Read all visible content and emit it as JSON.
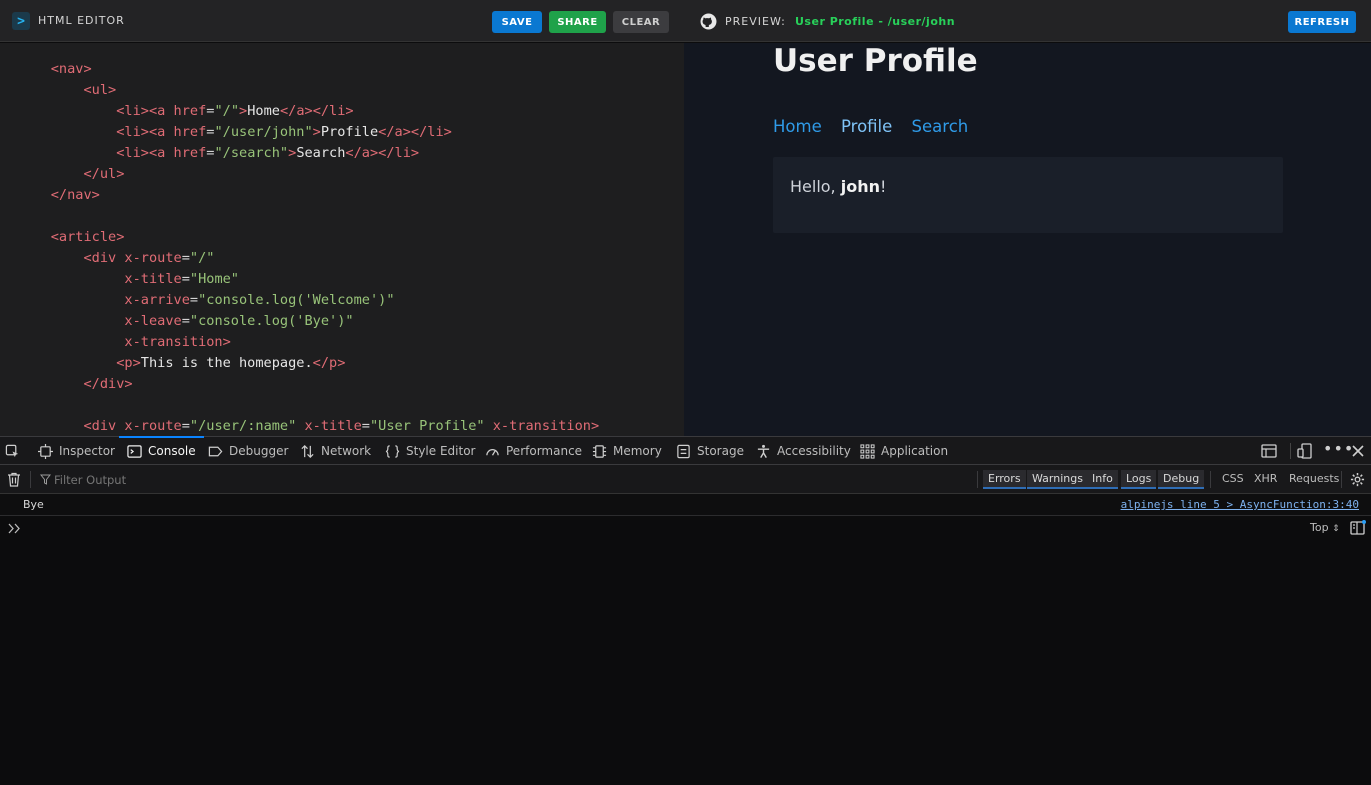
{
  "app": {
    "title": "HTML EDITOR",
    "buttons": {
      "save": "SAVE",
      "share": "SHARE",
      "clear": "CLEAR",
      "refresh": "REFRESH"
    },
    "preview_label": "PREVIEW:",
    "preview_url": "User Profile - /user/john",
    "colors": {
      "save": "#0a78d1",
      "share": "#1fa24a",
      "clear": "#3c3c3f",
      "url": "#28d15a"
    }
  },
  "preview": {
    "heading": "User Profile",
    "nav": [
      "Home",
      "Profile",
      "Search"
    ],
    "greeting_prefix": "Hello, ",
    "greeting_name": "john",
    "greeting_suffix": "!"
  },
  "devtools": {
    "tabs": [
      "Inspector",
      "Console",
      "Debugger",
      "Network",
      "Style Editor",
      "Performance",
      "Memory",
      "Storage",
      "Accessibility",
      "Application"
    ],
    "active_tab": "Console",
    "filter_placeholder": "Filter Output",
    "filters": [
      "Errors",
      "Warnings",
      "Info",
      "Logs",
      "Debug"
    ],
    "extra_filters": [
      "CSS",
      "XHR",
      "Requests"
    ],
    "log": {
      "message": "Bye",
      "source": "alpinejs line 5 > AsyncFunction:3:40"
    },
    "context": "Top"
  }
}
